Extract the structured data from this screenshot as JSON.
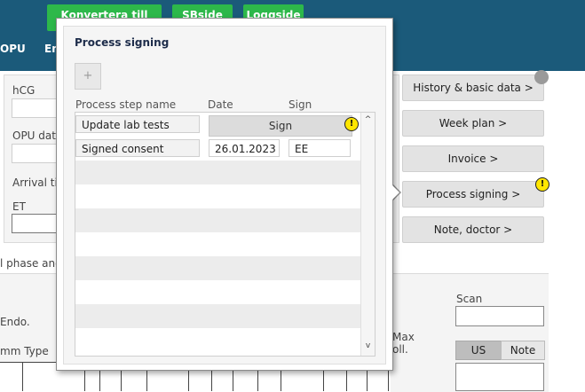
{
  "topbar": {
    "green_buttons": [
      "Konvertera till tiping",
      "SBside",
      "Loggside"
    ],
    "nav": [
      "OPU",
      "En"
    ]
  },
  "background_form": {
    "hcg_label": "hCG",
    "opu_date_label": "OPU date",
    "arrival_label": "Arrival tin",
    "et_label": "ET",
    "phase_text": "l phase and",
    "endo_text": "Endo.",
    "mm_type_text": "mm Type",
    "max_text": "Max",
    "foll_text": "oll.",
    "scan_label": "Scan",
    "us_tab": "US",
    "note_tab": "Note"
  },
  "side_buttons": [
    {
      "label": "History & basic data >"
    },
    {
      "label": "Week plan >"
    },
    {
      "label": "Invoice >"
    },
    {
      "label": "Process signing >"
    },
    {
      "label": "Note, doctor >"
    }
  ],
  "warning_glyph": "!",
  "modal": {
    "title": "Process signing",
    "add_label": "+",
    "columns": {
      "step": "Process step name",
      "date": "Date",
      "sign": "Sign"
    },
    "rows": [
      {
        "step": "Update lab tests",
        "sign_button": "Sign"
      },
      {
        "step": "Signed consent",
        "date": "26.01.2023",
        "sign": "EE"
      }
    ],
    "scroll_up": "^",
    "scroll_down": "v"
  },
  "colors": {
    "topbar": "#1b5a7a",
    "green_button": "#2db84a",
    "warning": "#ffe600"
  }
}
